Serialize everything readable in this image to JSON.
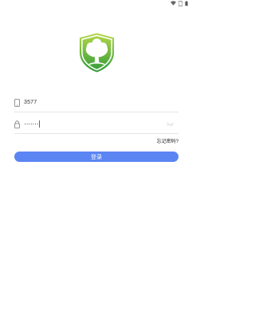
{
  "status": {
    "icons": [
      "wifi-icon",
      "sim-off-icon",
      "battery-icon"
    ]
  },
  "login": {
    "phone_value": "3577",
    "password_value": "·······",
    "forgot_label": "忘记密码?",
    "login_button_label": "登录"
  },
  "colors": {
    "primary": "#5b85f3",
    "logo_green": "#4caf50"
  }
}
